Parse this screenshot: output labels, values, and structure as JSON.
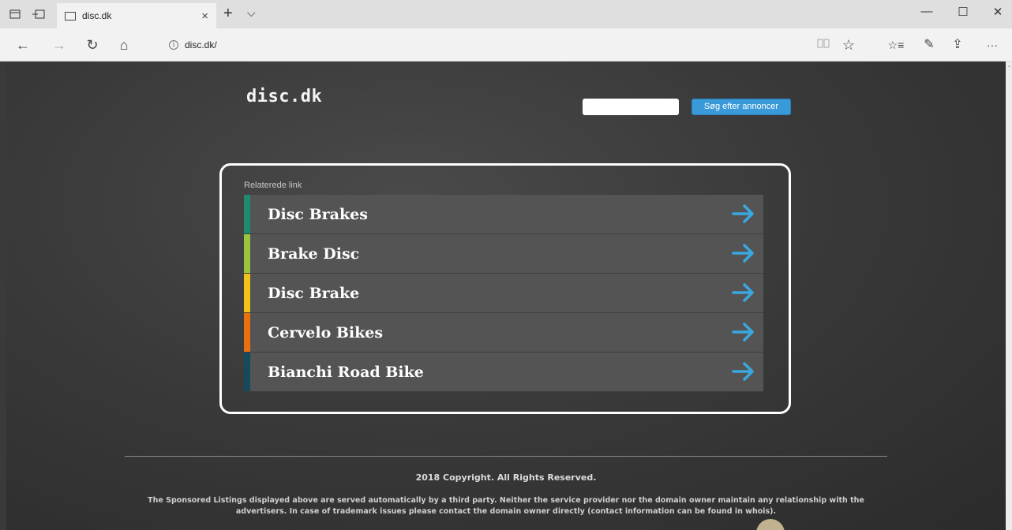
{
  "browser": {
    "tab_title": "disc.dk",
    "tab_close": "×",
    "new_tab": "+",
    "tab_menu": "⌵",
    "address": "disc.dk/",
    "window_controls": {
      "minimize": "—",
      "maximize": "☐",
      "close": "✕"
    },
    "nav_icons": {
      "back": "←",
      "forward": "→",
      "refresh": "↻",
      "home": "⌂",
      "reading_view": "📖",
      "favorite": "☆",
      "favorites_hub": "☆≡",
      "notes": "✎",
      "share": "⇪",
      "more": "···"
    }
  },
  "page": {
    "logo": "disc.dk",
    "search": {
      "placeholder": "",
      "button_label": "Søg efter annoncer"
    },
    "related": {
      "title": "Relaterede link",
      "links": [
        {
          "label": "Disc Brakes",
          "color": "#1e8a6e"
        },
        {
          "label": "Brake Disc",
          "color": "#9ac43a"
        },
        {
          "label": "Disc Brake",
          "color": "#f2c21a"
        },
        {
          "label": "Cervelo Bikes",
          "color": "#e8700f"
        },
        {
          "label": "Bianchi Road Bike",
          "color": "#134a5c"
        }
      ],
      "arrow_color": "#3aa8e0"
    },
    "footer": {
      "copyright": "2018 Copyright. All Rights Reserved.",
      "disclaimer": "The Sponsored Listings displayed above are served automatically by a third party. Neither the service provider nor the domain owner maintain any relationship with the advertisers. In case of trademark issues please contact the domain owner directly (contact information can be found in whois)."
    }
  }
}
